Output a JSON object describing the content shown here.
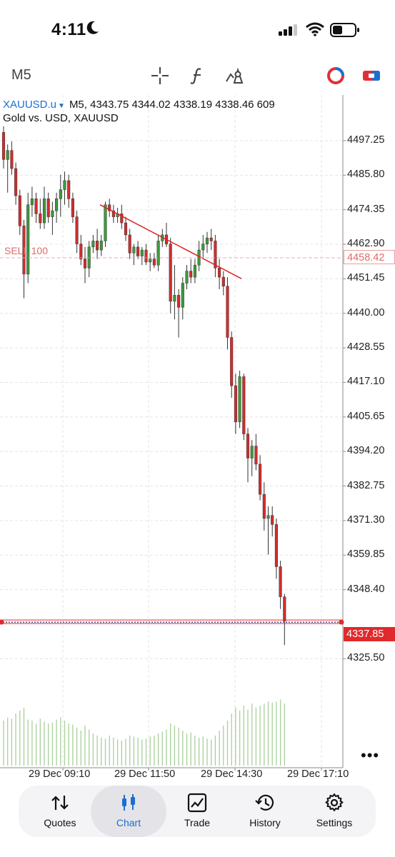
{
  "status_bar": {
    "time": "4:11"
  },
  "toolbar": {
    "timeframe": "M5"
  },
  "symbol_info": {
    "symbol": "XAUUSD.u",
    "caret": "▼",
    "quote_line": "M5, 4343.75 4344.02 4338.19 4338.46 609",
    "description": "Gold vs. USD, XAUUSD"
  },
  "order_line": {
    "label": "SELL 100",
    "price_tag": "4458.42",
    "color": "#e06a6a"
  },
  "current_price_tag": "4337.85",
  "colors": {
    "bull": "#3c9a3c",
    "bear": "#d42c2c",
    "volume": "#a8cf9a",
    "accent": "#1b6fd1",
    "trendline": "#e02020"
  },
  "more_menu": "•••",
  "chart_data": {
    "type": "candlestick",
    "ylim": [
      4318,
      4506
    ],
    "y_ticks": [
      "4497.25",
      "4485.80",
      "4474.35",
      "4462.90",
      "4451.45",
      "4440.00",
      "4428.55",
      "4417.10",
      "4405.65",
      "4394.20",
      "4382.75",
      "4371.30",
      "4359.85",
      "4348.40",
      "4325.50"
    ],
    "x_ticks": [
      "29 Dec 09:10",
      "29 Dec 11:50",
      "29 Dec 14:30",
      "29 Dec 17:10"
    ],
    "sell_level": 4458.42,
    "current_price": 4337.85,
    "trendline": [
      [
        4476.0,
        0
      ],
      [
        4451.5,
        1
      ]
    ],
    "candles": [
      [
        4500,
        4502,
        4488,
        4491
      ],
      [
        4491,
        4496,
        4480,
        4494
      ],
      [
        4494,
        4497,
        4486,
        4488
      ],
      [
        4488,
        4490,
        4476,
        4479
      ],
      [
        4479,
        4481,
        4466,
        4469
      ],
      [
        4469,
        4471,
        4445,
        4453
      ],
      [
        4453,
        4480,
        4450,
        4476
      ],
      [
        4476,
        4482,
        4472,
        4478
      ],
      [
        4478,
        4480,
        4470,
        4473
      ],
      [
        4473,
        4478,
        4468,
        4470
      ],
      [
        4470,
        4482,
        4468,
        4478
      ],
      [
        4478,
        4480,
        4470,
        4472
      ],
      [
        4472,
        4477,
        4466,
        4474
      ],
      [
        4474,
        4480,
        4470,
        4478
      ],
      [
        4478,
        4486,
        4472,
        4481
      ],
      [
        4481,
        4487,
        4476,
        4484
      ],
      [
        4484,
        4486,
        4475,
        4478
      ],
      [
        4478,
        4480,
        4470,
        4472
      ],
      [
        4472,
        4474,
        4460,
        4463
      ],
      [
        4463,
        4466,
        4456,
        4458
      ],
      [
        4458,
        4462,
        4450,
        4455
      ],
      [
        4455,
        4464,
        4452,
        4462
      ],
      [
        4462,
        4466,
        4460,
        4464
      ],
      [
        4464,
        4468,
        4458,
        4461
      ],
      [
        4461,
        4466,
        4459,
        4464
      ],
      [
        4464,
        4477,
        4462,
        4476
      ],
      [
        4476,
        4478,
        4472,
        4474
      ],
      [
        4474,
        4476,
        4470,
        4472
      ],
      [
        4472,
        4475,
        4470,
        4473
      ],
      [
        4473,
        4476,
        4468,
        4470
      ],
      [
        4470,
        4472,
        4464,
        4466
      ],
      [
        4466,
        4468,
        4458,
        4460
      ],
      [
        4460,
        4463,
        4456,
        4462
      ],
      [
        4462,
        4464,
        4458,
        4459
      ],
      [
        4459,
        4462,
        4456,
        4461
      ],
      [
        4461,
        4463,
        4456,
        4457
      ],
      [
        4457,
        4460,
        4454,
        4458
      ],
      [
        4458,
        4460,
        4455,
        4456
      ],
      [
        4456,
        4466,
        4454,
        4464
      ],
      [
        4464,
        4468,
        4462,
        4466
      ],
      [
        4466,
        4470,
        4462,
        4463
      ],
      [
        4463,
        4465,
        4440,
        4444
      ],
      [
        4444,
        4456,
        4438,
        4446
      ],
      [
        4446,
        4448,
        4432,
        4442
      ],
      [
        4442,
        4452,
        4438,
        4450
      ],
      [
        4450,
        4456,
        4448,
        4454
      ],
      [
        4454,
        4458,
        4450,
        4452
      ],
      [
        4452,
        4458,
        4450,
        4456
      ],
      [
        4456,
        4464,
        4454,
        4461
      ],
      [
        4461,
        4466,
        4458,
        4463
      ],
      [
        4463,
        4467,
        4460,
        4465
      ],
      [
        4465,
        4468,
        4461,
        4464
      ],
      [
        4464,
        4466,
        4452,
        4455
      ],
      [
        4455,
        4458,
        4448,
        4452
      ],
      [
        4452,
        4454,
        4446,
        4449
      ],
      [
        4449,
        4452,
        4428,
        4432
      ],
      [
        4432,
        4434,
        4412,
        4416
      ],
      [
        4416,
        4420,
        4400,
        4404
      ],
      [
        4404,
        4421,
        4402,
        4419
      ],
      [
        4419,
        4420,
        4398,
        4400
      ],
      [
        4400,
        4402,
        4384,
        4392
      ],
      [
        4392,
        4398,
        4386,
        4396
      ],
      [
        4396,
        4400,
        4388,
        4390
      ],
      [
        4390,
        4393,
        4378,
        4380
      ],
      [
        4380,
        4384,
        4368,
        4372
      ],
      [
        4372,
        4376,
        4360,
        4373
      ],
      [
        4373,
        4376,
        4366,
        4370
      ],
      [
        4370,
        4372,
        4352,
        4356
      ],
      [
        4356,
        4358,
        4342,
        4346
      ],
      [
        4346,
        4347,
        4330,
        4338
      ]
    ],
    "volume": [
      0.45,
      0.48,
      0.47,
      0.52,
      0.55,
      0.58,
      0.46,
      0.45,
      0.42,
      0.47,
      0.44,
      0.42,
      0.43,
      0.46,
      0.48,
      0.45,
      0.42,
      0.41,
      0.38,
      0.35,
      0.4,
      0.36,
      0.32,
      0.3,
      0.28,
      0.27,
      0.3,
      0.28,
      0.26,
      0.25,
      0.27,
      0.3,
      0.29,
      0.28,
      0.26,
      0.27,
      0.29,
      0.3,
      0.32,
      0.34,
      0.36,
      0.42,
      0.4,
      0.38,
      0.35,
      0.32,
      0.33,
      0.3,
      0.28,
      0.29,
      0.27,
      0.26,
      0.3,
      0.35,
      0.4,
      0.45,
      0.52,
      0.58,
      0.55,
      0.6,
      0.56,
      0.62,
      0.58,
      0.6,
      0.62,
      0.64,
      0.63,
      0.64,
      0.66,
      0.62
    ]
  },
  "tabs": [
    {
      "label": "Quotes",
      "icon": "quotes-icon"
    },
    {
      "label": "Chart",
      "icon": "chart-icon"
    },
    {
      "label": "Trade",
      "icon": "trade-icon"
    },
    {
      "label": "History",
      "icon": "history-icon"
    },
    {
      "label": "Settings",
      "icon": "settings-icon"
    }
  ]
}
